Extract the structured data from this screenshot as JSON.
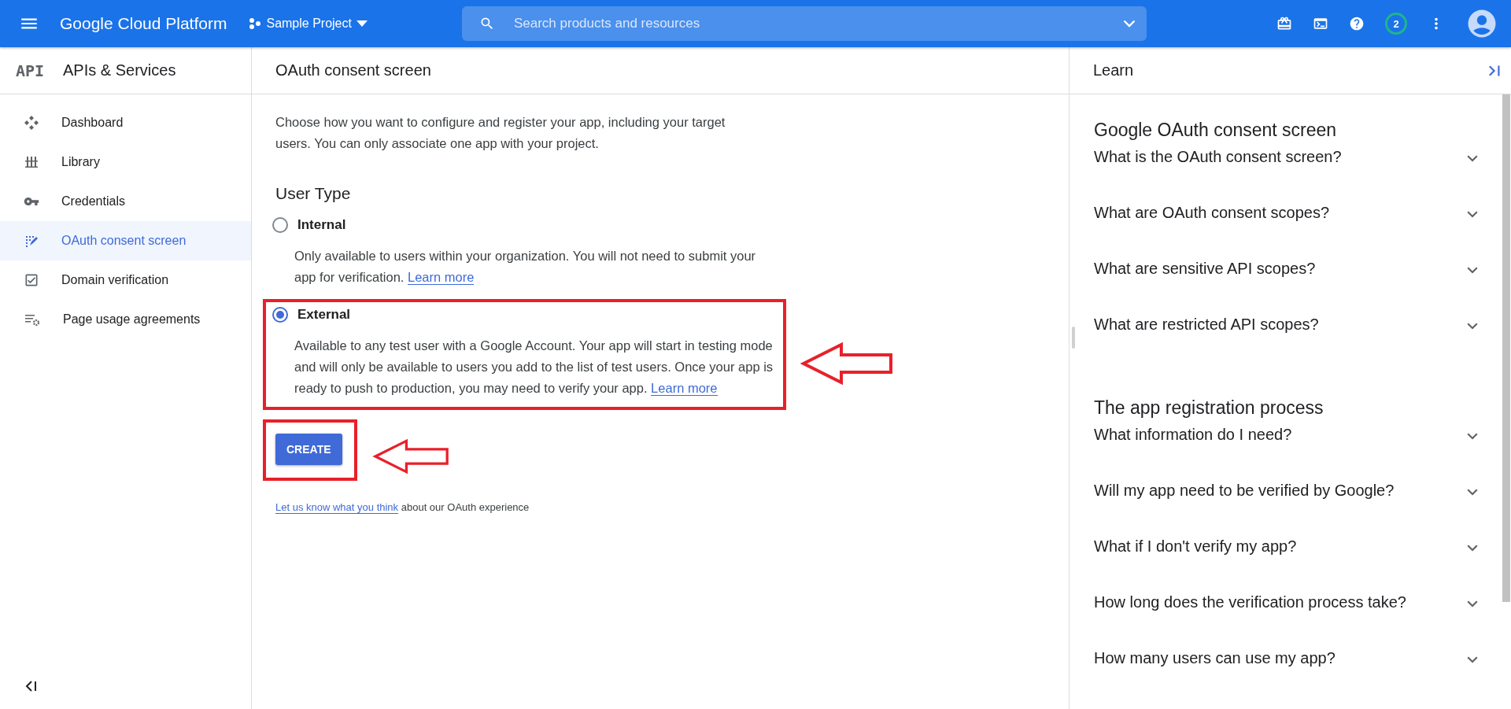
{
  "top_bar": {
    "title": "Google Cloud Platform",
    "project": "Sample Project",
    "search": {
      "placeholder": "Search products and resources"
    },
    "notification_count": "2"
  },
  "sidebar": {
    "logo": "API",
    "title": "APIs & Services",
    "items": [
      {
        "label": "Dashboard",
        "selected": false
      },
      {
        "label": "Library",
        "selected": false
      },
      {
        "label": "Credentials",
        "selected": false
      },
      {
        "label": "OAuth consent screen",
        "selected": true
      },
      {
        "label": "Domain verification",
        "selected": false
      },
      {
        "label": "Page usage agreements",
        "selected": false
      }
    ]
  },
  "main": {
    "title": "OAuth consent screen",
    "intro": "Choose how you want to configure and register your app, including your target users. You can only associate one app with your project.",
    "section_title": "User Type",
    "options": [
      {
        "label": "Internal",
        "description": "Only available to users within your organization. You will not need to submit your app for verification.",
        "link": "Learn more",
        "selected": false,
        "highlighted": false
      },
      {
        "label": "External",
        "description": "Available to any test user with a Google Account. Your app will start in testing mode and will only be available to users you add to the list of test users. Once your app is ready to push to production, you may need to verify your app.",
        "link": "Learn more",
        "selected": true,
        "highlighted": true
      }
    ],
    "create_button": {
      "label": "CREATE",
      "highlighted": true
    },
    "feedback": {
      "link": "Let us know what you think",
      "text": "about our OAuth experience"
    }
  },
  "learn_panel": {
    "title": "Learn",
    "sections": [
      {
        "heading": "Google OAuth consent screen",
        "items": [
          {
            "question": "What is the OAuth consent screen?",
            "expanded": false
          },
          {
            "question": "What are OAuth consent scopes?",
            "expanded": false
          },
          {
            "question": "What are sensitive API scopes?",
            "expanded": false
          },
          {
            "question": "What are restricted API scopes?",
            "expanded": false
          }
        ]
      },
      {
        "heading": "The app registration process",
        "items": [
          {
            "question": "What information do I need?",
            "expanded": false
          },
          {
            "question": "Will my app need to be verified by Google?",
            "expanded": false
          },
          {
            "question": "What if I don't verify my app?",
            "expanded": false
          },
          {
            "question": "How long does the verification process take?",
            "expanded": false
          },
          {
            "question": "How many users can use my app?",
            "expanded": false
          }
        ]
      }
    ]
  }
}
